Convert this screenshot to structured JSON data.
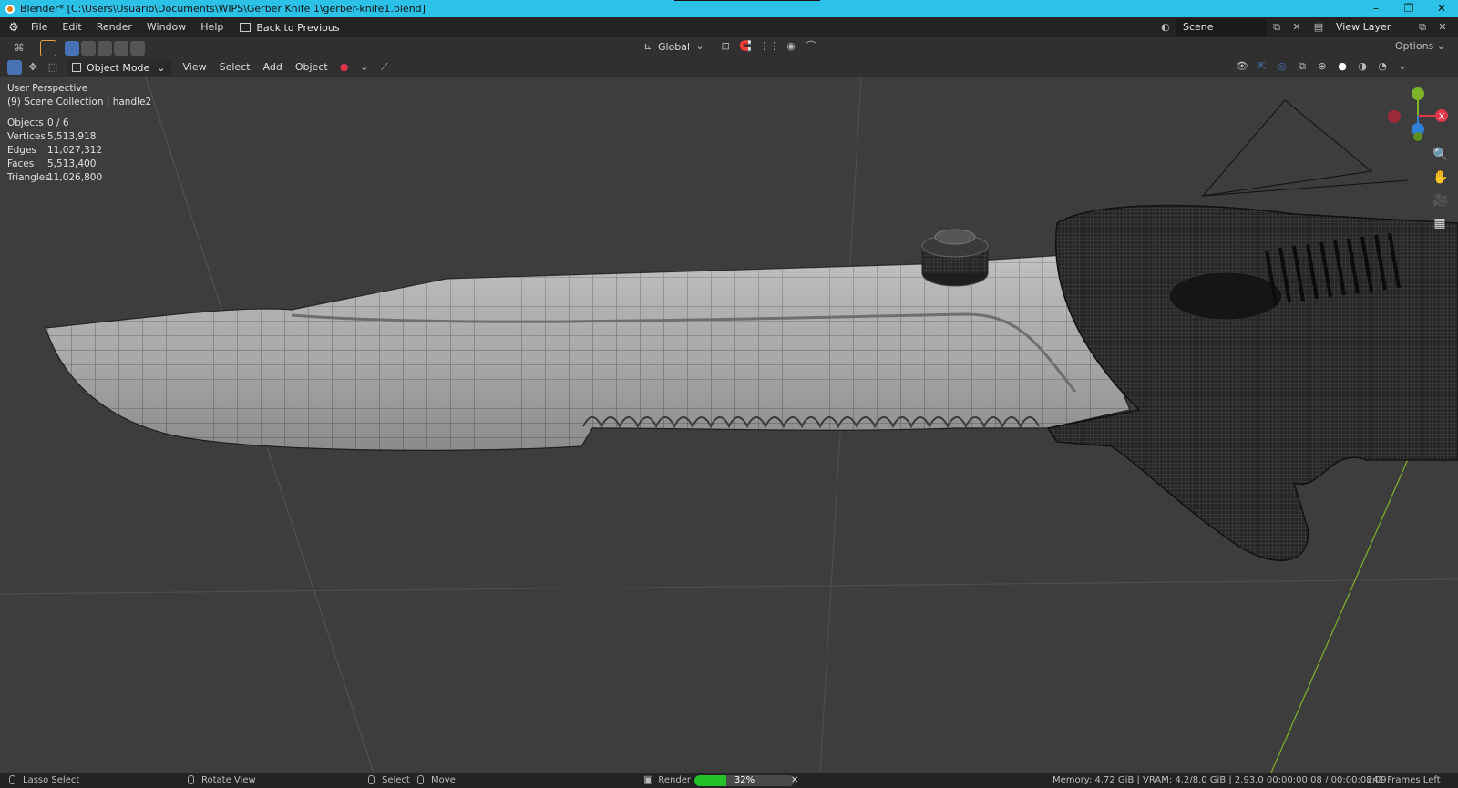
{
  "window": {
    "title": "Blender* [C:\\Users\\Usuario\\Documents\\WIPS\\Gerber Knife 1\\gerber-knife1.blend]",
    "controls": [
      "–",
      "❐",
      "✕"
    ]
  },
  "menu": {
    "items": [
      "File",
      "Edit",
      "Render",
      "Window",
      "Help"
    ],
    "back_label": "Back to Previous",
    "scene_label": "Scene",
    "view_layer_label": "View Layer"
  },
  "toolbar": {
    "transform_orientation": "Global",
    "options_label": "Options"
  },
  "header": {
    "mode_label": "Object Mode",
    "menus": [
      "View",
      "Select",
      "Add",
      "Object"
    ]
  },
  "viewport": {
    "view_name": "User Perspective",
    "collection": "(9) Scene Collection | handle2",
    "stats": [
      {
        "label": "Objects",
        "value": "0 / 6"
      },
      {
        "label": "Vertices",
        "value": "5,513,918"
      },
      {
        "label": "Edges",
        "value": "11,027,312"
      },
      {
        "label": "Faces",
        "value": "5,513,400"
      },
      {
        "label": "Triangles",
        "value": "11,026,800"
      }
    ]
  },
  "statusbar": {
    "lasso": "Lasso Select",
    "rotate": "Rotate View",
    "select": "Select",
    "move": "Move",
    "render_label": "Render",
    "render_progress": 0.32,
    "render_pct_text": "32%",
    "memory": "Memory: 4.72 GiB | VRAM: 4.2/8.0 GiB | 2.93.0  00:00:00:08 / 00:00:08:09",
    "frames_left": "241 Frames Left"
  },
  "colors": {
    "titlebar": "#2cc2e8",
    "accent": "#4772b3",
    "progress": "#22c22a",
    "axis_x": "#e0364a",
    "axis_y": "#7eb32b",
    "axis_z": "#2f7fd8"
  }
}
